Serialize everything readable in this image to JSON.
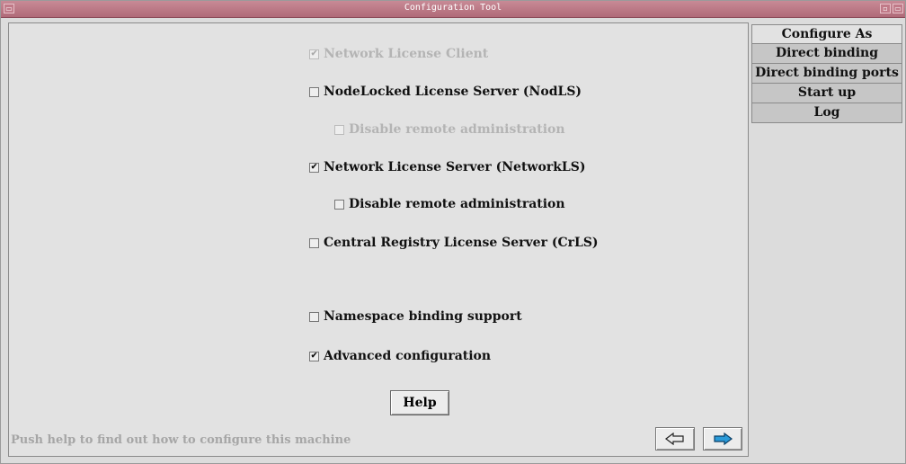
{
  "window": {
    "title": "Configuration Tool",
    "min_glyph": "▭",
    "max_glyph": "▫"
  },
  "options": {
    "network_license_client": {
      "label": "Network License Client",
      "checked": true,
      "enabled": false
    },
    "nodelocked_server": {
      "label": "NodeLocked License Server (NodLS)",
      "checked": false,
      "enabled": true
    },
    "nodelocked_disable_remote": {
      "label": "Disable remote administration",
      "checked": false,
      "enabled": false
    },
    "network_server": {
      "label": "Network License Server (NetworkLS)",
      "checked": true,
      "enabled": true
    },
    "network_disable_remote": {
      "label": "Disable remote administration",
      "checked": false,
      "enabled": true
    },
    "central_registry": {
      "label": "Central Registry License Server (CrLS)",
      "checked": false,
      "enabled": true
    },
    "namespace_binding": {
      "label": "Namespace binding support",
      "checked": false,
      "enabled": true
    },
    "advanced_config": {
      "label": "Advanced configuration",
      "checked": true,
      "enabled": true
    }
  },
  "help_button": {
    "label": "Help"
  },
  "status": {
    "text": "Push help to find out how to configure this machine"
  },
  "nav": {
    "back_icon": "hollow-left-arrow-icon",
    "next_icon": "blue-right-arrow-icon",
    "next_color": "#2a9ad8"
  },
  "tabs": [
    {
      "label": "Configure As",
      "active": true
    },
    {
      "label": "Direct binding",
      "active": false
    },
    {
      "label": "Direct binding ports",
      "active": false
    },
    {
      "label": "Start up",
      "active": false
    },
    {
      "label": "Log",
      "active": false
    }
  ],
  "colors": {
    "titlebar": "#b87684",
    "background": "#dcdcdc",
    "disabled_text": "#b4b4b4"
  }
}
